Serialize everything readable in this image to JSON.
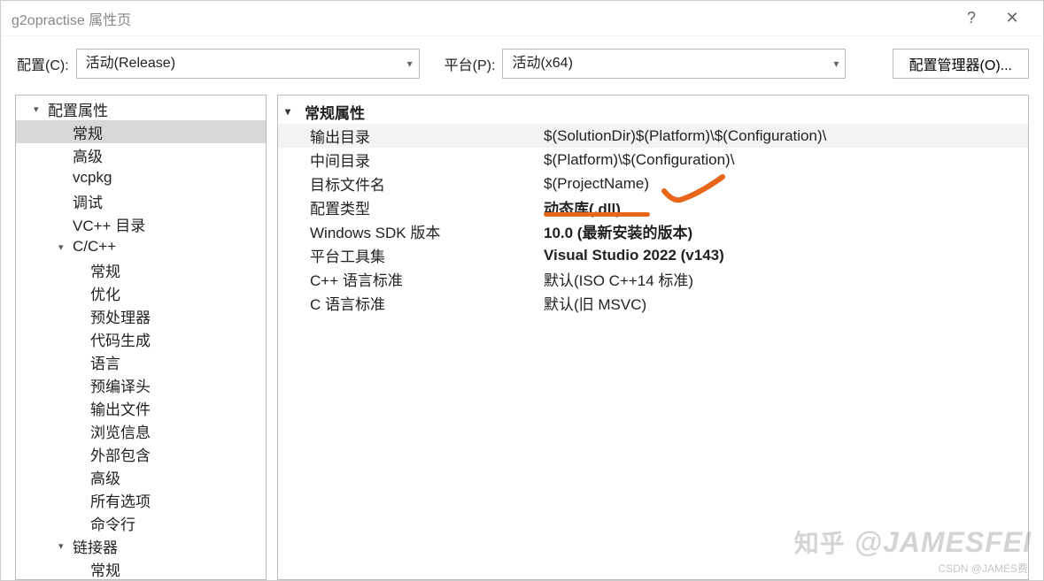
{
  "title": "g2opractise 属性页",
  "titlebar": {
    "help": "?",
    "close": "✕"
  },
  "toolbar": {
    "config_label": "配置(C):",
    "config_value": "活动(Release)",
    "platform_label": "平台(P):",
    "platform_value": "活动(x64)",
    "manager_btn": "配置管理器(O)..."
  },
  "tree": [
    {
      "label": "配置属性",
      "indent": 1,
      "caret": "▾"
    },
    {
      "label": "常规",
      "indent": 2,
      "selected": true
    },
    {
      "label": "高级",
      "indent": 2
    },
    {
      "label": "vcpkg",
      "indent": 2
    },
    {
      "label": "调试",
      "indent": 2
    },
    {
      "label": "VC++ 目录",
      "indent": 2
    },
    {
      "label": "C/C++",
      "indent": 2,
      "caret": "▾"
    },
    {
      "label": "常规",
      "indent": 3
    },
    {
      "label": "优化",
      "indent": 3
    },
    {
      "label": "预处理器",
      "indent": 3
    },
    {
      "label": "代码生成",
      "indent": 3
    },
    {
      "label": "语言",
      "indent": 3
    },
    {
      "label": "预编译头",
      "indent": 3
    },
    {
      "label": "输出文件",
      "indent": 3
    },
    {
      "label": "浏览信息",
      "indent": 3
    },
    {
      "label": "外部包含",
      "indent": 3
    },
    {
      "label": "高级",
      "indent": 3
    },
    {
      "label": "所有选项",
      "indent": 3
    },
    {
      "label": "命令行",
      "indent": 3
    },
    {
      "label": "链接器",
      "indent": 2,
      "caret": "▾"
    },
    {
      "label": "常规",
      "indent": 3
    }
  ],
  "props": {
    "group": "常规属性",
    "rows": [
      {
        "label": "输出目录",
        "value": "$(SolutionDir)$(Platform)\\$(Configuration)\\",
        "sel": true
      },
      {
        "label": "中间目录",
        "value": "$(Platform)\\$(Configuration)\\"
      },
      {
        "label": "目标文件名",
        "value": "$(ProjectName)"
      },
      {
        "label": "配置类型",
        "value": "动态库(.dll)",
        "bold": true
      },
      {
        "label": "Windows SDK 版本",
        "value": "10.0 (最新安装的版本)",
        "bold": true
      },
      {
        "label": "平台工具集",
        "value": "Visual Studio 2022 (v143)",
        "bold": true
      },
      {
        "label": "C++ 语言标准",
        "value": "默认(ISO C++14 标准)"
      },
      {
        "label": "C 语言标准",
        "value": "默认(旧 MSVC)"
      }
    ]
  },
  "watermark": {
    "main_zh": "知乎",
    "main_en": "@JAMESFEI",
    "sub": "CSDN @JAMES费"
  },
  "annotation_color": "#e8651a"
}
